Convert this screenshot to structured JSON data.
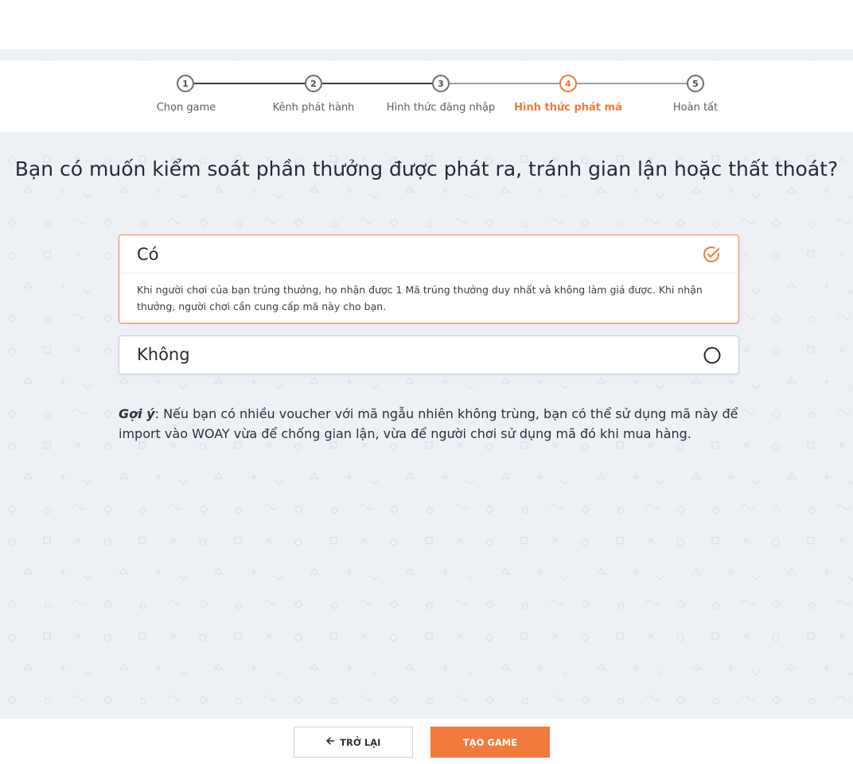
{
  "steps": [
    {
      "number": "1",
      "label": "Chọn game"
    },
    {
      "number": "2",
      "label": "Kênh phát hành"
    },
    {
      "number": "3",
      "label": "Hình thức đăng nhập"
    },
    {
      "number": "4",
      "label": "Hình thức phát mã"
    },
    {
      "number": "5",
      "label": "Hoàn tất"
    }
  ],
  "active_step": "4",
  "question": "Bạn có muốn kiểm soát phần thưởng được phát ra, tránh gian lận hoặc thất thoát?",
  "options": [
    {
      "title": "Có",
      "description": "Khi người chơi của bạn trúng thưởng, họ nhận được 1 Mã trúng thưởng duy nhất và không làm giả được. Khi nhận thưởng, người chơi cần cung cấp mã này cho bạn.",
      "selected": true
    },
    {
      "title": "Không",
      "selected": false
    }
  ],
  "hint": {
    "label": "Gợi ý",
    "text": ": Nếu bạn có nhiều voucher với mã ngẫu nhiên không trùng, bạn có thể sử dụng mã này để import vào WOAY vừa để chống gian lận, vừa để người chơi sử dụng mã đó khi mua hàng."
  },
  "footer": {
    "back_label": "TRỞ LẠI",
    "create_label": "TẠO GAME"
  },
  "colors": {
    "accent": "#f27a3c",
    "background": "#edf0f5"
  },
  "icons": {
    "back": "arrow-left-icon",
    "selected": "check-circle-icon",
    "unselected": "radio-empty-icon"
  }
}
